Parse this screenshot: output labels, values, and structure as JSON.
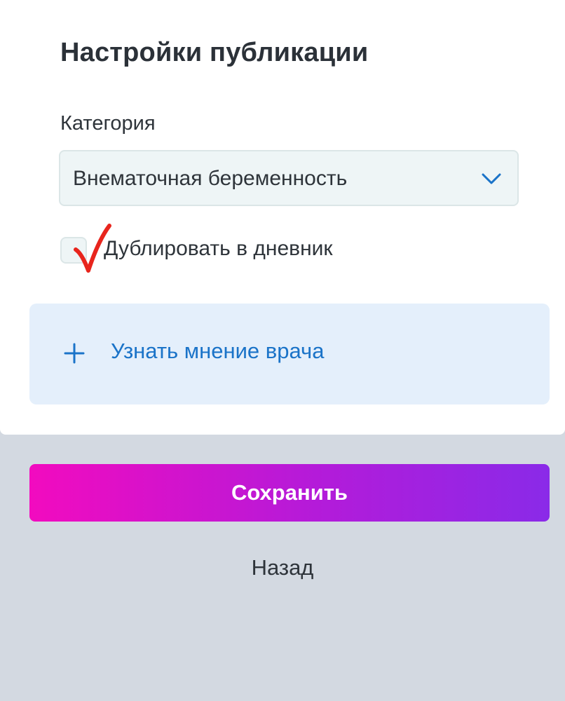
{
  "sheet": {
    "title": "Настройки публикации",
    "category_label": "Категория",
    "category_value": "Внематочная беременность",
    "duplicate_label": "Дублировать в дневник",
    "duplicate_checked": true,
    "doctor_label": "Узнать мнение врача"
  },
  "footer": {
    "save_label": "Сохранить",
    "back_label": "Назад"
  },
  "icons": {
    "dropdown": "chevron-down-icon",
    "check": "checkmark-icon",
    "add": "plus-icon"
  },
  "colors": {
    "accent_blue": "#1a73c8",
    "check_red": "#e8251d",
    "gradient_start": "#f20bbf",
    "gradient_end": "#8a2ae8",
    "background": "#d3d9e1"
  }
}
